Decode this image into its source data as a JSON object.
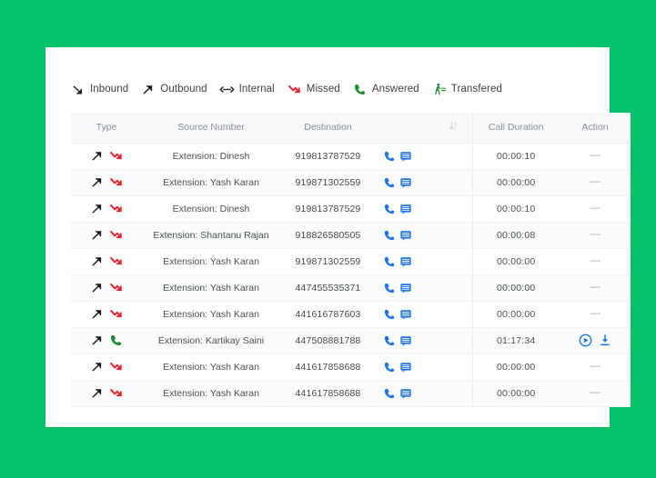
{
  "legend": {
    "items": [
      {
        "icon": "inbound-arrow-icon",
        "label": "Inbound"
      },
      {
        "icon": "outbound-arrow-icon",
        "label": "Outbound"
      },
      {
        "icon": "internal-arrows-icon",
        "label": "Internal"
      },
      {
        "icon": "missed-call-icon",
        "label": "Missed"
      },
      {
        "icon": "answered-call-icon",
        "label": "Answered"
      },
      {
        "icon": "transferred-call-icon",
        "label": "Transfered"
      }
    ]
  },
  "table": {
    "headers": {
      "type": "Type",
      "source_number": "Source Number",
      "destination": "Destination",
      "sort": "sort-icon",
      "call_duration": "Call Duration",
      "action": "Action"
    },
    "rows": [
      {
        "direction": "outbound",
        "status": "missed",
        "source": "Extension: Dinesh",
        "destination": "919813787529",
        "duration": "00:00:10",
        "action": "----"
      },
      {
        "direction": "outbound",
        "status": "missed",
        "source": "Extension: Yash Karan",
        "destination": "919871302559",
        "duration": "00:00:00",
        "action": "----"
      },
      {
        "direction": "outbound",
        "status": "missed",
        "source": "Extension: Dinesh",
        "destination": "919813787529",
        "duration": "00:00:10",
        "action": "----"
      },
      {
        "direction": "outbound",
        "status": "missed",
        "source": "Extension: Shantanu Rajan",
        "destination": "918826580505",
        "duration": "00:00:08",
        "action": "----"
      },
      {
        "direction": "outbound",
        "status": "missed",
        "source": "Extension: Yash Karan",
        "destination": "919871302559",
        "duration": "00:00:00",
        "action": "----"
      },
      {
        "direction": "outbound",
        "status": "missed",
        "source": "Extension: Yash Karan",
        "destination": "447455535371",
        "duration": "00:00:00",
        "action": "----"
      },
      {
        "direction": "outbound",
        "status": "missed",
        "source": "Extension: Yash Karan",
        "destination": "441616787603",
        "duration": "00:00:00",
        "action": "----"
      },
      {
        "direction": "outbound",
        "status": "answered",
        "source": "Extension: Kartikay Saini",
        "destination": "447508881788",
        "duration": "01:17:34",
        "action": "media"
      },
      {
        "direction": "outbound",
        "status": "missed",
        "source": "Extension: Yash Karan",
        "destination": "441617858688",
        "duration": "00:00:00",
        "action": "----"
      },
      {
        "direction": "outbound",
        "status": "missed",
        "source": "Extension: Yash Karan",
        "destination": "441617858688",
        "duration": "00:00:00",
        "action": "----"
      }
    ]
  },
  "colors": {
    "page_background": "#04c368",
    "card_background": "#ffffff",
    "missed": "#e8202a",
    "answered": "#1f8b33",
    "outbound_arrow": "#1a1a1a",
    "contact_icon": "#1a73e8",
    "action_icon": "#1a73e8",
    "header_background": "#f7f8f9",
    "header_text": "#8b9096"
  }
}
